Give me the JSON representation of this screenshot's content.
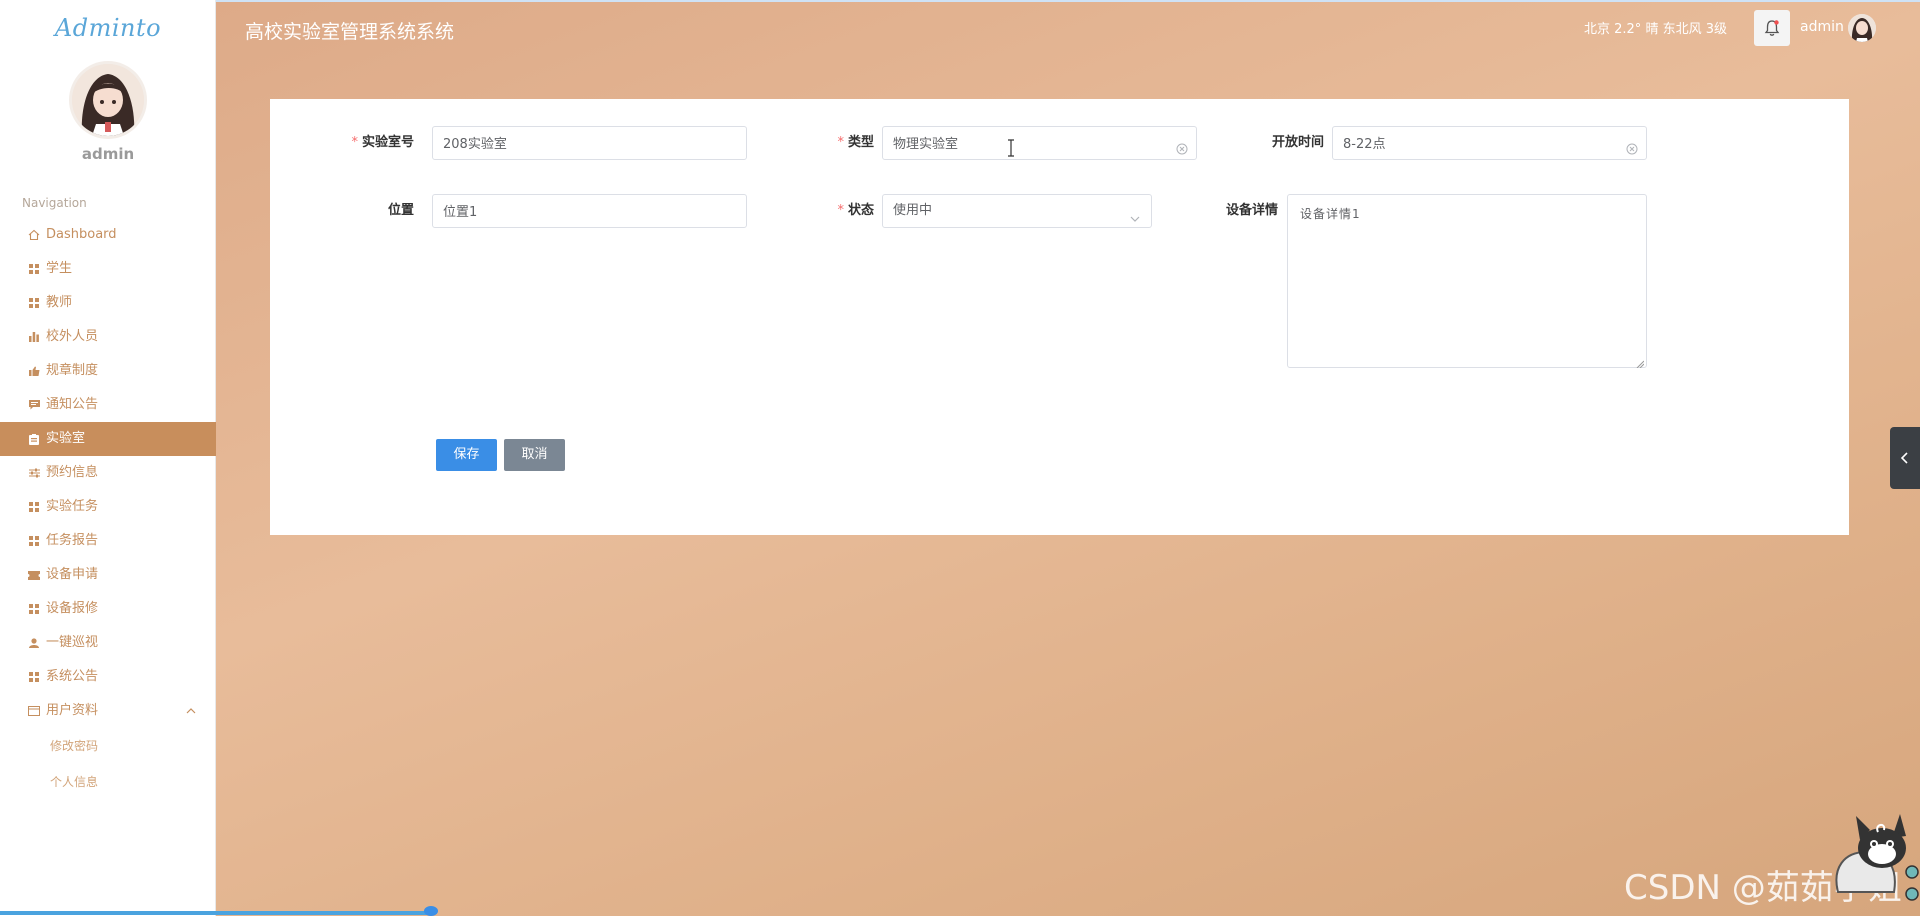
{
  "brand": "Adminto",
  "user": {
    "name": "admin"
  },
  "nav": {
    "title": "Navigation",
    "items": [
      {
        "label": "Dashboard",
        "icon": "home-icon"
      },
      {
        "label": "学生",
        "icon": "grid-icon"
      },
      {
        "label": "教师",
        "icon": "grid-icon"
      },
      {
        "label": "校外人员",
        "icon": "bar-chart-icon"
      },
      {
        "label": "规章制度",
        "icon": "thumbs-up-icon"
      },
      {
        "label": "通知公告",
        "icon": "message-icon"
      },
      {
        "label": "实验室",
        "icon": "clipboard-icon",
        "active": true
      },
      {
        "label": "预约信息",
        "icon": "sliders-icon"
      },
      {
        "label": "实验任务",
        "icon": "grid-icon"
      },
      {
        "label": "任务报告",
        "icon": "grid-icon"
      },
      {
        "label": "设备申请",
        "icon": "ticket-icon"
      },
      {
        "label": "设备报修",
        "icon": "grid-icon"
      },
      {
        "label": "一键巡视",
        "icon": "user-icon"
      },
      {
        "label": "系统公告",
        "icon": "grid-icon"
      },
      {
        "label": "用户资料",
        "icon": "id-card-icon"
      }
    ],
    "sub_items": [
      "修改密码",
      "个人信息"
    ]
  },
  "header": {
    "title": "高校实验室管理系统系统",
    "weather": "北京  2.2°  晴  东北风  3级",
    "user": "admin"
  },
  "form": {
    "room_no": {
      "label": "实验室号",
      "value": "208实验室"
    },
    "type": {
      "label": "类型",
      "value": "物理实验室"
    },
    "open_time": {
      "label": "开放时间",
      "value": "8-22点"
    },
    "location": {
      "label": "位置",
      "value": "位置1"
    },
    "status": {
      "label": "状态",
      "value": "使用中"
    },
    "equipment": {
      "label": "设备详情",
      "value": "设备详情1"
    },
    "save_label": "保存",
    "cancel_label": "取消"
  },
  "watermark": "CSDN @茹茹学姐",
  "colors": {
    "accent": "#c88e5c",
    "primary_button": "#3a8ee6",
    "secondary_button": "#7b8794",
    "required_mark": "#f56c6c"
  }
}
